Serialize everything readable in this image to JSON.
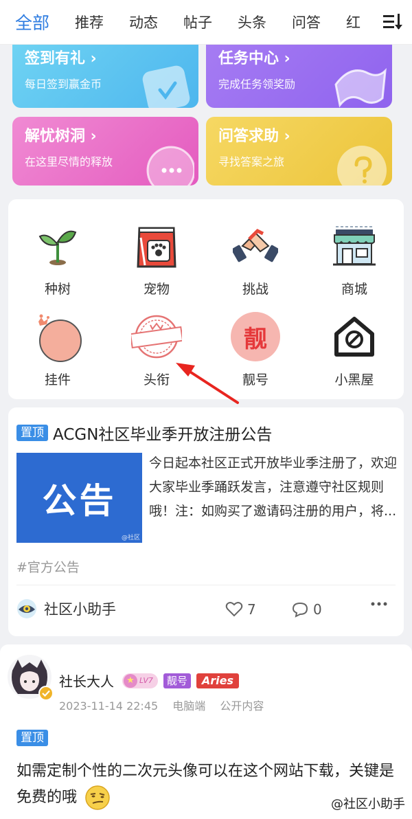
{
  "tabs": [
    {
      "label": "全部",
      "active": true
    },
    {
      "label": "推荐",
      "active": false
    },
    {
      "label": "动态",
      "active": false
    },
    {
      "label": "帖子",
      "active": false
    },
    {
      "label": "头条",
      "active": false
    },
    {
      "label": "问答",
      "active": false
    },
    {
      "label": "红",
      "active": false
    }
  ],
  "feature_cards": [
    {
      "title": "签到有礼 ›",
      "subtitle": "每日签到赢金币",
      "icon": "calendar-check-icon"
    },
    {
      "title": "任务中心 ›",
      "subtitle": "完成任务领奖励",
      "icon": "flag-icon"
    },
    {
      "title": "解忧树洞 ›",
      "subtitle": "在这里尽情的释放",
      "icon": "chat-bubble-icon"
    },
    {
      "title": "问答求助 ›",
      "subtitle": "寻找答案之旅",
      "icon": "question-icon"
    }
  ],
  "grid_items": [
    {
      "label": "种树",
      "icon": "sprout-icon"
    },
    {
      "label": "宠物",
      "icon": "pet-food-bag-icon"
    },
    {
      "label": "挑战",
      "icon": "handshake-icon"
    },
    {
      "label": "商城",
      "icon": "shop-icon"
    },
    {
      "label": "挂件",
      "icon": "pendant-icon"
    },
    {
      "label": "头衔",
      "icon": "title-badge-icon"
    },
    {
      "label": "靓号",
      "icon": "vip-number-icon"
    },
    {
      "label": "小黑屋",
      "icon": "blacklist-house-icon"
    }
  ],
  "post1": {
    "pin_label": "置顶",
    "title": "ACGN社区毕业季开放注册公告",
    "thumb_text": "公告",
    "thumb_watermark": "@社区",
    "body": "今日起本社区正式开放毕业季注册了，欢迎大家毕业季踊跃发言，注意遵守社区规则哦！注：如购买了邀请码注册的用户，将...",
    "hashtag": "#官方公告",
    "author": "社区小助手",
    "likes": "7",
    "comments": "0"
  },
  "post2": {
    "username": "社长大人",
    "level_badge": "LV7",
    "vip_badge": "靓号",
    "title_badge": "Aries",
    "date": "2023-11-14 22:45",
    "device": "电脑端",
    "visibility": "公开内容",
    "pin_label": "置顶",
    "body": "如需定制个性的二次元头像可以在这个网站下载，关键是免费的哦"
  },
  "watermark": "@社区小助手",
  "colors": {
    "accent": "#2f7de1",
    "pin": "#3a8ee6",
    "arrow": "#e8251f",
    "card_signin": "#5ecaf0",
    "card_task": "#9b6ff0",
    "card_tree": "#ee6ac7",
    "card_qa": "#f0cc4a"
  }
}
